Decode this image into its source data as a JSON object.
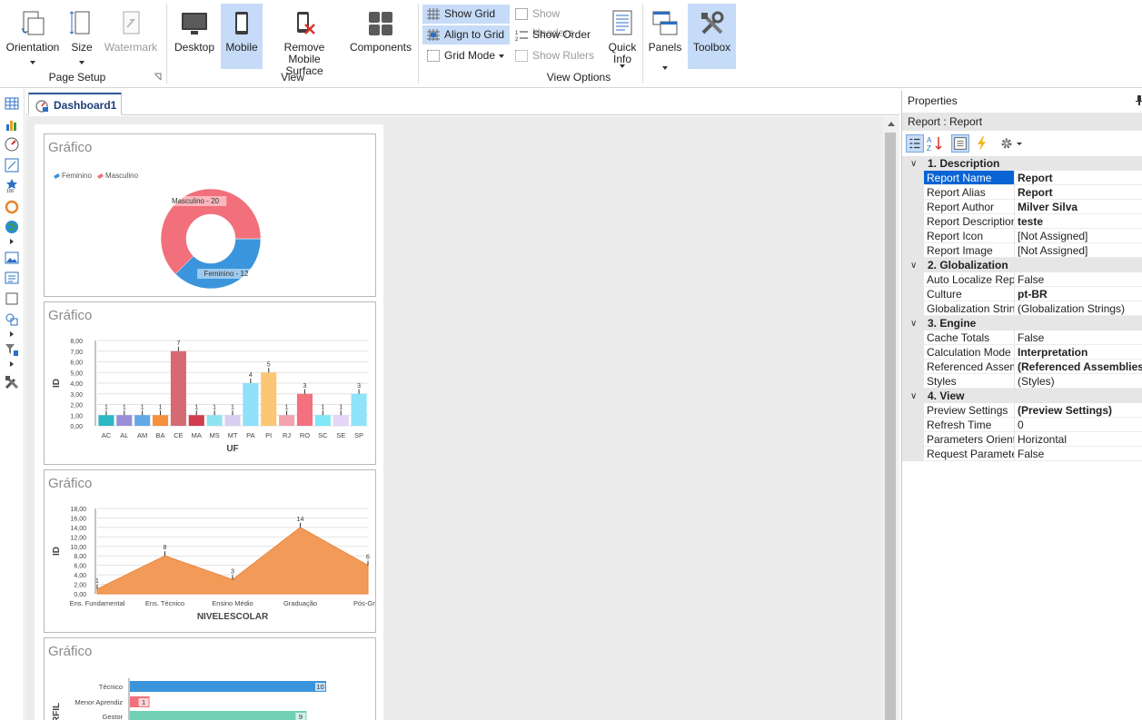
{
  "ribbon": {
    "page_setup": {
      "orientation": "Orientation",
      "size": "Size",
      "watermark": "Watermark",
      "group_label": "Page Setup"
    },
    "view": {
      "desktop": "Desktop",
      "mobile": "Mobile",
      "remove_mobile_surface_l1": "Remove Mobile",
      "remove_mobile_surface_l2": "Surface",
      "components": "Components",
      "group_label": "View"
    },
    "view_options": {
      "show_grid": "Show Grid",
      "align_to_grid": "Align to Grid",
      "grid_mode": "Grid Mode",
      "show_headers": "Show Headers",
      "show_order": "Show Order",
      "show_rulers": "Show Rulers",
      "quick_info_l1": "Quick",
      "quick_info_l2": "Info",
      "group_label": "View Options"
    },
    "panels": "Panels",
    "toolbox": "Toolbox"
  },
  "document": {
    "tab_label": "Dashboard1"
  },
  "panels": [
    {
      "title": "Gráfico"
    },
    {
      "title": "Gráfico"
    },
    {
      "title": "Gráfico"
    },
    {
      "title": "Gráfico"
    }
  ],
  "chart_data": [
    {
      "type": "pie",
      "title": "Gráfico",
      "legend": [
        "Feminino",
        "Masculino"
      ],
      "categories": [
        "Feminino",
        "Masculino"
      ],
      "values": [
        12,
        20
      ],
      "labels": [
        "Feminino - 12",
        "Masculino - 20"
      ],
      "colors": [
        "#3b95dc",
        "#f1707b"
      ],
      "legend_position": "top-left"
    },
    {
      "type": "bar",
      "title": "Gráfico",
      "xlabel": "UF",
      "ylabel": "ID",
      "categories": [
        "AC",
        "AL",
        "AM",
        "BA",
        "CE",
        "MA",
        "MS",
        "MT",
        "PA",
        "PI",
        "RJ",
        "RO",
        "SC",
        "SE",
        "SP"
      ],
      "values": [
        1,
        1,
        1,
        1,
        7,
        1,
        1,
        1,
        4,
        5,
        1,
        3,
        1,
        1,
        3
      ],
      "colors": [
        "#2eb7c4",
        "#9b8dd6",
        "#63a9e4",
        "#f5903d",
        "#d56a73",
        "#d13c4f",
        "#8fe3f0",
        "#d8cff0",
        "#8fe0f8",
        "#fcc675",
        "#f4a3b1",
        "#f4707f",
        "#7fe8f6",
        "#e3d6f6",
        "#8fe3fa"
      ],
      "yticks": [
        "0,00",
        "1,00",
        "2,00",
        "3,00",
        "4,00",
        "5,00",
        "6,00",
        "7,00",
        "8,00"
      ],
      "ylim": [
        0,
        8
      ],
      "grid": true
    },
    {
      "type": "area",
      "title": "Gráfico",
      "xlabel": "NIVELESCOLAR",
      "ylabel": "ID",
      "categories": [
        "Ens. Fundamental",
        "Ens. Técnico",
        "Ensino Médio",
        "Graduação",
        "Pós-Grad"
      ],
      "values": [
        1,
        8,
        3,
        14,
        6
      ],
      "color": "#f29b58",
      "yticks": [
        "0,00",
        "2,00",
        "4,00",
        "6,00",
        "8,00",
        "10,00",
        "12,00",
        "14,00",
        "16,00",
        "18,00"
      ],
      "ylim": [
        0,
        18
      ],
      "grid": true
    },
    {
      "type": "bar",
      "orientation": "horizontal",
      "title": "Gráfico",
      "ylabel": "RFIL",
      "categories": [
        "Técnico",
        "Menor Aprendiz",
        "Gestor"
      ],
      "values": [
        10,
        1,
        9
      ],
      "colors": [
        "#3b95dc",
        "#f1707b",
        "#6fd0b4"
      ]
    }
  ],
  "properties": {
    "header": "Properties",
    "object": "Report : Report",
    "categories": [
      {
        "label": "1. Description",
        "rows": [
          {
            "k": "Report Name",
            "v": "Report",
            "bold": true,
            "selected": true
          },
          {
            "k": "Report Alias",
            "v": "Report",
            "bold": true
          },
          {
            "k": "Report Author",
            "v": "Milver Silva",
            "bold": true
          },
          {
            "k": "Report Description",
            "v": "teste",
            "bold": true
          },
          {
            "k": "Report Icon",
            "v": "[Not Assigned]"
          },
          {
            "k": "Report Image",
            "v": "[Not Assigned]"
          }
        ]
      },
      {
        "label": "2. Globalization",
        "rows": [
          {
            "k": "Auto Localize Repor",
            "v": "False"
          },
          {
            "k": "Culture",
            "v": "pt-BR",
            "bold": true
          },
          {
            "k": "Globalization Strings",
            "v": "(Globalization Strings)"
          }
        ]
      },
      {
        "label": "3. Engine",
        "rows": [
          {
            "k": "Cache Totals",
            "v": "False"
          },
          {
            "k": "Calculation Mode",
            "v": "Interpretation",
            "bold": true
          },
          {
            "k": "Referenced Assemb",
            "v": "(Referenced Assemblies",
            "bold": true
          },
          {
            "k": "Styles",
            "v": "(Styles)"
          }
        ]
      },
      {
        "label": "4. View",
        "rows": [
          {
            "k": "Preview Settings",
            "v": "(Preview Settings)",
            "bold": true
          },
          {
            "k": "Refresh Time",
            "v": "0"
          },
          {
            "k": "Parameters Orientati",
            "v": "Horizontal"
          },
          {
            "k": "Request Parameters",
            "v": "False"
          }
        ]
      }
    ]
  }
}
